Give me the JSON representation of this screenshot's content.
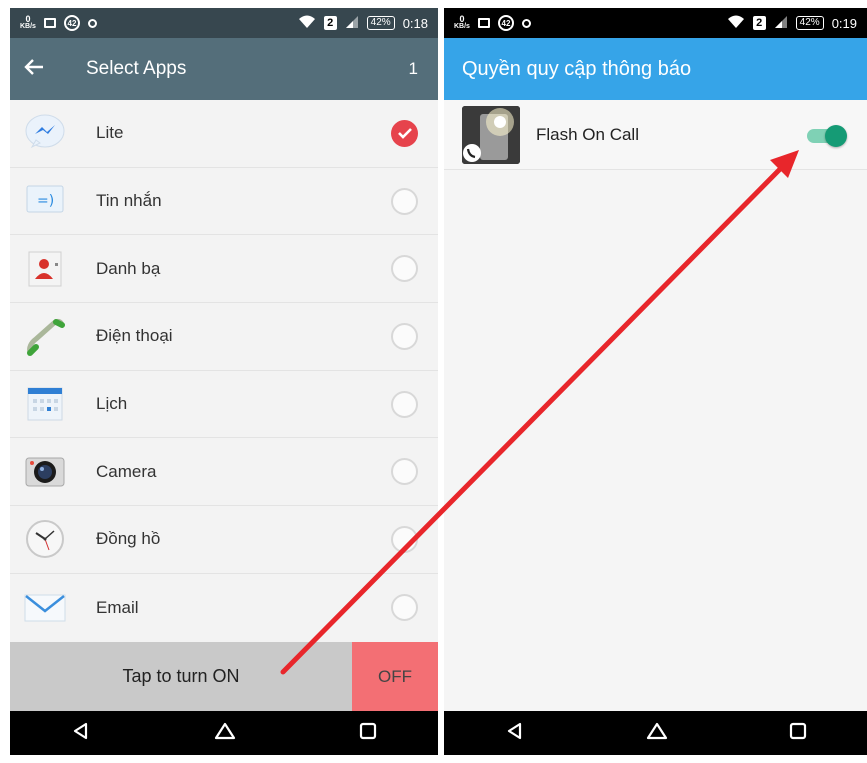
{
  "left": {
    "status": {
      "net_top": "0",
      "net_bottom": "KB/s",
      "circle_num": "42",
      "battery": "42%",
      "time": "0:18",
      "sim": "2"
    },
    "appbar": {
      "title": "Select Apps",
      "count": "1"
    },
    "apps": [
      {
        "label": "Lite",
        "checked": true
      },
      {
        "label": "Tin nhắn",
        "checked": false
      },
      {
        "label": "Danh bạ",
        "checked": false
      },
      {
        "label": "Điện thoại",
        "checked": false
      },
      {
        "label": "Lịch",
        "checked": false
      },
      {
        "label": "Camera",
        "checked": false
      },
      {
        "label": "Đồng hồ",
        "checked": false
      },
      {
        "label": "Email",
        "checked": false
      }
    ],
    "bottom": {
      "on_label": "Tap to turn ON",
      "off_label": "OFF"
    }
  },
  "right": {
    "status": {
      "net_top": "0",
      "net_bottom": "KB/s",
      "circle_num": "42",
      "battery": "42%",
      "time": "0:19",
      "sim": "2"
    },
    "appbar": {
      "title": "Quyền quy cập thông báo"
    },
    "permission": {
      "label": "Flash On Call",
      "enabled": true
    }
  },
  "colors": {
    "left_appbar": "#546e7a",
    "right_appbar": "#36a4e8",
    "check": "#e6434c",
    "off": "#f36f74",
    "toggle": "#159b75",
    "arrow": "#e8262b"
  },
  "icons": {
    "nav": [
      "back-triangle-icon",
      "home-icon",
      "recents-square-icon"
    ],
    "apps": [
      "messenger-lite-icon",
      "messages-icon",
      "contacts-icon",
      "phone-icon",
      "calendar-icon",
      "camera-icon",
      "clock-icon",
      "email-icon"
    ]
  }
}
